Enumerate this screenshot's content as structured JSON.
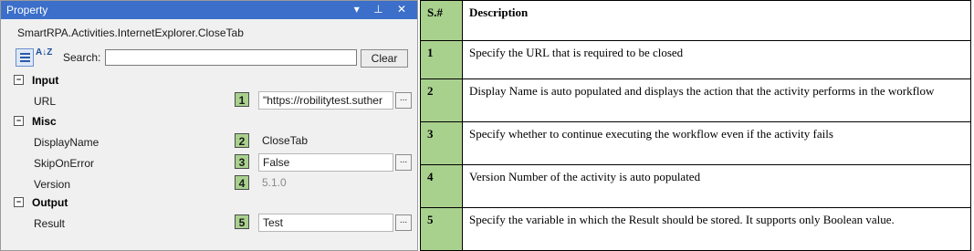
{
  "panel": {
    "title": "Property",
    "title_icons": "▾ ⊥ ✕",
    "class_name": "SmartRPA.Activities.InternetExplorer.CloseTab",
    "az_icon": "A↓Z",
    "search_label": "Search:",
    "search_value": "",
    "clear_label": "Clear",
    "collapse_symbol": "−",
    "ellipsis": "...",
    "groups": {
      "input": "Input",
      "misc": "Misc",
      "output": "Output"
    },
    "props": [
      {
        "name": "URL",
        "num": "1",
        "value": "\"https://robilitytest.suther"
      },
      {
        "name": "DisplayName",
        "num": "2",
        "value": "CloseTab"
      },
      {
        "name": "SkipOnError",
        "num": "3",
        "value": "False"
      },
      {
        "name": "Version",
        "num": "4",
        "value": "5.1.0"
      },
      {
        "name": "Result",
        "num": "5",
        "value": "Test"
      }
    ]
  },
  "table": {
    "headers": {
      "num": "S.#",
      "desc": "Description"
    },
    "rows": [
      {
        "num": "1",
        "desc": "Specify the URL that is required to be closed"
      },
      {
        "num": "2",
        "desc": "Display Name is auto populated and displays the action that the activity performs in the workflow"
      },
      {
        "num": "3",
        "desc": "Specify whether to continue executing the workflow even if the activity fails"
      },
      {
        "num": "4",
        "desc": "Version Number of the activity is auto populated"
      },
      {
        "num": "5",
        "desc": "Specify the variable in which the Result should be stored. It supports only Boolean value."
      }
    ]
  },
  "colors": {
    "accent": "#3b6fc9",
    "marker_green": "#a9d18e"
  }
}
